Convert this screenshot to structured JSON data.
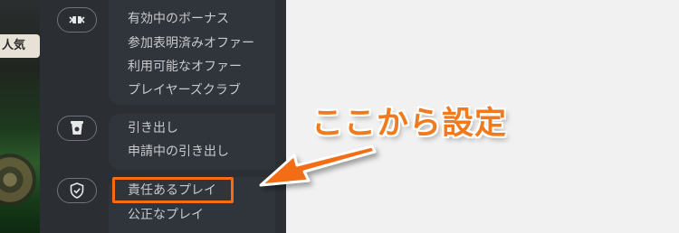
{
  "background": {
    "logo_text": "人気"
  },
  "menu": {
    "bonus_group": {
      "icon": "gift-icon",
      "items": [
        "有効中のボーナス",
        "参加表明済みオファー",
        "利用可能なオファー",
        "プレイヤーズクラブ"
      ]
    },
    "withdraw_group": {
      "icon": "cup-icon",
      "items": [
        "引き出し",
        "申請中の引き出し"
      ]
    },
    "responsible_group": {
      "icon": "shield-check-icon",
      "items": [
        "責任あるプレイ",
        "公正なプレイ"
      ]
    }
  },
  "annotation": {
    "text": "ここから設定",
    "color": "#f07a1d",
    "highlight_color": "#f36d14"
  }
}
